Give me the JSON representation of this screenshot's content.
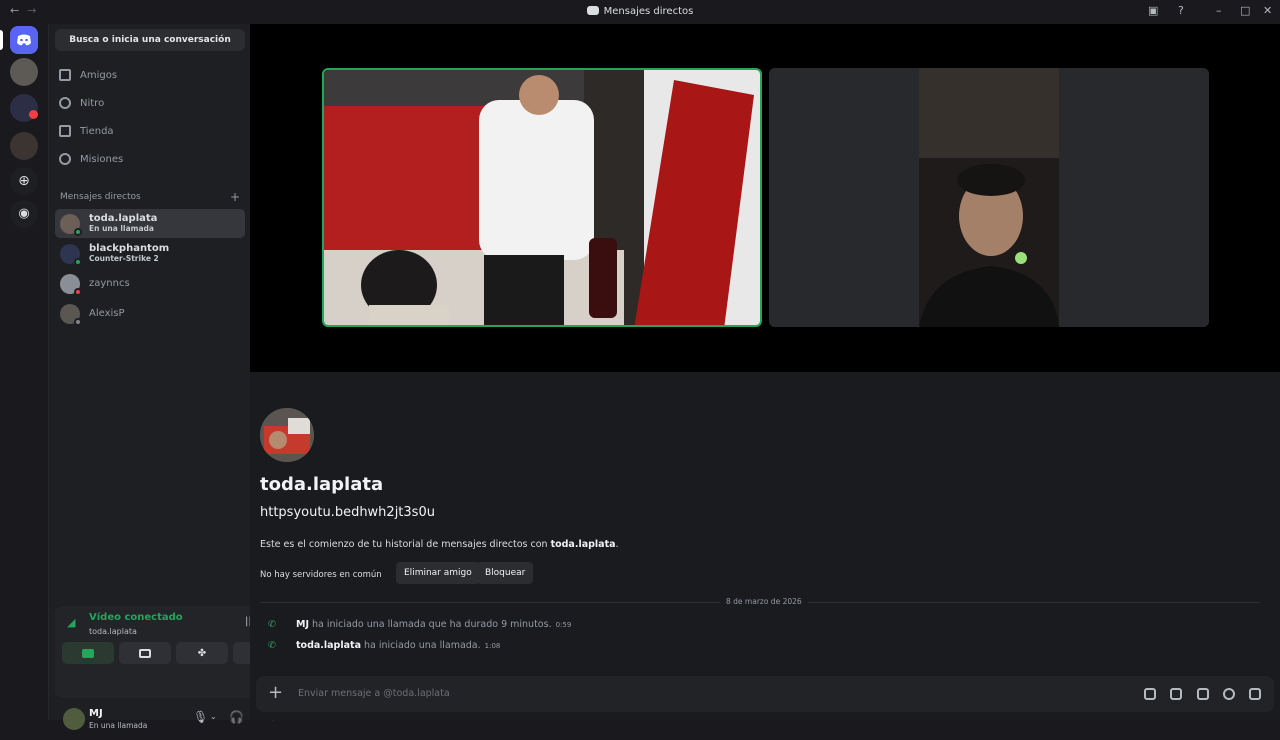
{
  "window": {
    "title": "Mensajes directos"
  },
  "sidebar": {
    "search_label": "Busca o inicia una conversación",
    "nav": [
      {
        "label": "Amigos",
        "icon": "friends-icon"
      },
      {
        "label": "Nitro",
        "icon": "nitro-icon"
      },
      {
        "label": "Tienda",
        "icon": "shop-icon"
      },
      {
        "label": "Misiones",
        "icon": "quests-icon"
      }
    ],
    "dm_header": "Mensajes directos",
    "dms": [
      {
        "name": "toda.laplata",
        "status": "En una llamada",
        "active": true
      },
      {
        "name": "blackphantom",
        "status": "Counter-Strike 2"
      },
      {
        "name": "zaynncs",
        "status": ""
      },
      {
        "name": "AlexisP",
        "status": ""
      }
    ]
  },
  "voice": {
    "title": "Vídeo conectado",
    "channel": "toda.laplata"
  },
  "user": {
    "name": "MJ",
    "status": "En una llamada"
  },
  "chat": {
    "name": "toda.laplata",
    "link": "httpsyoutu.bedhwh2jt3s0u",
    "desc_prefix": "Este es el comienzo de tu historial de mensajes directos con ",
    "desc_name": "toda.laplata",
    "desc_suffix": ".",
    "mutual": "No hay servidores en común",
    "remove_friend": "Eliminar amigo",
    "block": "Bloquear",
    "date": "8 de marzo de 2026",
    "messages": [
      {
        "author": "MJ",
        "text": " ha iniciado una llamada que ha durado 9 minutos.",
        "time": "0:59"
      },
      {
        "author": "toda.laplata",
        "text": " ha iniciado una llamada.",
        "time": "1:08"
      }
    ],
    "placeholder": "Enviar mensaje a @toda.laplata"
  },
  "colors": {
    "accent": "#5865f2",
    "green": "#23a55a",
    "red": "#f23f43"
  }
}
